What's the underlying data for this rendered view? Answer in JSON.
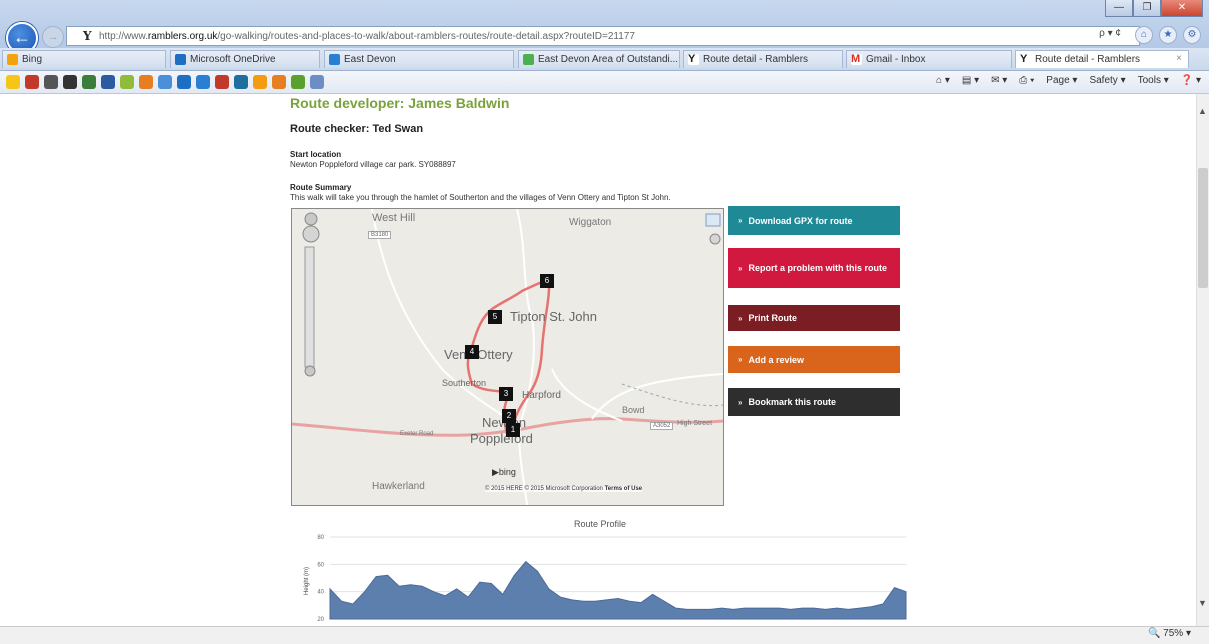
{
  "window": {
    "controls": [
      "—",
      "❐",
      "✕"
    ]
  },
  "address": {
    "url_prefix": "http://www.",
    "url_domain": "ramblers.org.uk",
    "url_rest": "/go-walking/routes-and-places-to-walk/about-ramblers-routes/route-detail.aspx?routeID=21177",
    "tools": "ρ ▾ ¢"
  },
  "tabs": [
    {
      "label": "Bing",
      "icon_color": "#f0a30a"
    },
    {
      "label": "Microsoft OneDrive",
      "icon_color": "#1e6fc4"
    },
    {
      "label": "East Devon",
      "icon_color": "#2a7fd4"
    },
    {
      "label": "East Devon Area of Outstandi...",
      "icon_color": "#4caf50"
    },
    {
      "label": "Route detail - Ramblers",
      "icon_color": "#333333"
    },
    {
      "label": "Gmail - Inbox",
      "icon_color": "#d93025"
    },
    {
      "label": "Route detail - Ramblers",
      "icon_color": "#333333",
      "active": true
    }
  ],
  "favorites_icons": [
    "#f5c518",
    "#c0392b",
    "#555555",
    "#333333",
    "#3b7d3b",
    "#2c5aa0",
    "#8fbc3b",
    "#e67e22",
    "#4a90d9",
    "#1e6fc4",
    "#2a7fd4",
    "#c0392b",
    "#1f6f9e",
    "#f39c12",
    "#e67e22",
    "#5aa02c",
    "#6d8ec4"
  ],
  "command_bar": {
    "items": [
      "Page ▾",
      "Safety ▾",
      "Tools ▾"
    ]
  },
  "page": {
    "developer": "Route developer: James Baldwin",
    "checker": "Route checker: Ted Swan",
    "start_label": "Start location",
    "start_text": "Newton Poppleford village car park. SY088897",
    "summary_label": "Route Summary",
    "summary_text": "This walk will take you through the hamlet of Southerton and the villages of Venn Ottery and Tipton St John."
  },
  "map": {
    "labels": {
      "west_hill": "West Hill",
      "wiggaton": "Wiggaton",
      "tipton": "Tipton St. John",
      "venn": "Venn Ottery",
      "southerton": "Southerton",
      "harpford": "Harpford",
      "newton1": "Newton",
      "newton2": "Poppleford",
      "hawkerland": "Hawkerland",
      "bowd": "Bowd",
      "high_street": "High Street",
      "exeter_road": "Exeter Road",
      "road1": "B3180",
      "road2": "A3052"
    },
    "markers": [
      "1",
      "2",
      "3",
      "4",
      "5",
      "6"
    ],
    "copyright": "© 2015 HERE © 2015 Microsoft Corporation",
    "terms": "Terms of Use",
    "bing": "bing"
  },
  "actions": [
    {
      "label": "Download GPX for route",
      "color": "#1f8a96"
    },
    {
      "label": "Report a problem with this route",
      "color": "#d1193f"
    },
    {
      "label": "Print Route",
      "color": "#7a1e24"
    },
    {
      "label": "Add a review",
      "color": "#d9651c"
    },
    {
      "label": "Bookmark this route",
      "color": "#2e2e2e"
    }
  ],
  "chart_data": {
    "type": "area",
    "title": "Route Profile",
    "ylabel": "Height (m)",
    "ytick_labels": [
      "80",
      "60",
      "40",
      "20"
    ],
    "ylim": [
      20,
      80
    ],
    "x": [
      0,
      2,
      4,
      6,
      8,
      10,
      12,
      14,
      16,
      18,
      20,
      22,
      24,
      26,
      28,
      30,
      32,
      34,
      36,
      38,
      40,
      42,
      44,
      46,
      48,
      50,
      52,
      54,
      56,
      58,
      60,
      62,
      64,
      66,
      68,
      70,
      72,
      74,
      76,
      78,
      80,
      82,
      84,
      86,
      88,
      90,
      92,
      94,
      96,
      98,
      100
    ],
    "values": [
      42,
      33,
      31,
      40,
      51,
      52,
      44,
      45,
      44,
      40,
      37,
      42,
      36,
      47,
      46,
      38,
      52,
      62,
      55,
      42,
      36,
      34,
      33,
      33,
      34,
      35,
      33,
      32,
      38,
      33,
      28,
      27,
      27,
      27,
      28,
      27,
      28,
      28,
      28,
      28,
      27,
      28,
      28,
      27,
      28,
      27,
      28,
      29,
      31,
      43,
      40
    ],
    "grid": true,
    "color": "#5d7fae"
  },
  "status": {
    "zoom": "75%"
  }
}
